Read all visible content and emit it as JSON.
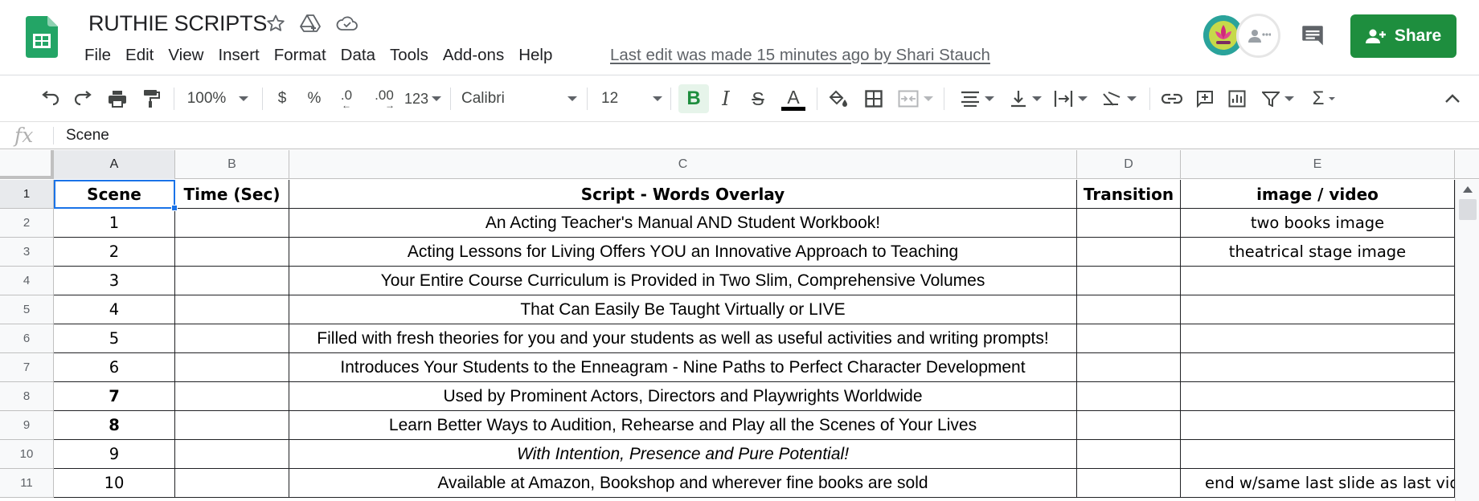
{
  "document": {
    "title": "RUTHIE SCRIPTS",
    "last_edit": "Last edit was made 15 minutes ago by Shari Stauch"
  },
  "menu": [
    "File",
    "Edit",
    "View",
    "Insert",
    "Format",
    "Data",
    "Tools",
    "Add-ons",
    "Help"
  ],
  "share": {
    "label": "Share"
  },
  "toolbar": {
    "zoom": "100%",
    "currency": "$",
    "percent": "%",
    "decrease_decimal": ".0",
    "increase_decimal": ".00",
    "more_formats": "123",
    "font": "Calibri",
    "font_size": "12",
    "bold": "B",
    "italic": "I",
    "strikethrough": "S",
    "text_color": "A",
    "text_color_hex": "#000000",
    "functions": "Σ"
  },
  "formula_bar": {
    "fx_label": "fx",
    "value": "Scene"
  },
  "columns": [
    "A",
    "B",
    "C",
    "D",
    "E"
  ],
  "row_numbers": [
    "1",
    "2",
    "3",
    "4",
    "5",
    "6",
    "7",
    "8",
    "9",
    "10",
    "11"
  ],
  "sheet": {
    "headers": [
      "Scene",
      "Time (Sec)",
      "Script - Words Overlay",
      "Transition",
      "image / video"
    ],
    "rows": [
      {
        "scene": "1",
        "time": "",
        "script": "An Acting Teacher's Manual AND Student Workbook!",
        "transition": "",
        "media": "two books image"
      },
      {
        "scene": "2",
        "time": "",
        "script": "Acting Lessons for Living Offers YOU an Innovative Approach to Teaching",
        "transition": "",
        "media": "theatrical stage image"
      },
      {
        "scene": "3",
        "time": "",
        "script": "Your Entire Course Curriculum is Provided in Two Slim, Comprehensive Volumes",
        "transition": "",
        "media": ""
      },
      {
        "scene": "4",
        "time": "",
        "script": "That Can Easily Be Taught Virtually or LIVE",
        "transition": "",
        "media": ""
      },
      {
        "scene": "5",
        "time": "",
        "script": "Filled with fresh theories for you and your students as well as useful activities and writing prompts!",
        "transition": "",
        "media": ""
      },
      {
        "scene": "6",
        "time": "",
        "script": "Introduces Your Students to the Enneagram - Nine Paths to Perfect Character Development",
        "transition": "",
        "media": ""
      },
      {
        "scene": "7",
        "time": "",
        "script": "Used by Prominent Actors, Directors and Playwrights Worldwide",
        "transition": "",
        "media": ""
      },
      {
        "scene": "8",
        "time": "",
        "script": "Learn Better Ways to Audition, Rehearse and Play all the Scenes of Your Lives",
        "transition": "",
        "media": ""
      },
      {
        "scene": "9",
        "time": "",
        "script": "With Intention, Presence and Pure Potential!",
        "transition": "",
        "media": ""
      },
      {
        "scene": "10",
        "time": "",
        "script": "Available at Amazon, Bookshop and wherever fine books are sold",
        "transition": "",
        "media": "end w/same last slide as last vid"
      }
    ]
  },
  "colors": {
    "brand_green": "#1e8e3e",
    "selection_blue": "#1a73e8"
  }
}
